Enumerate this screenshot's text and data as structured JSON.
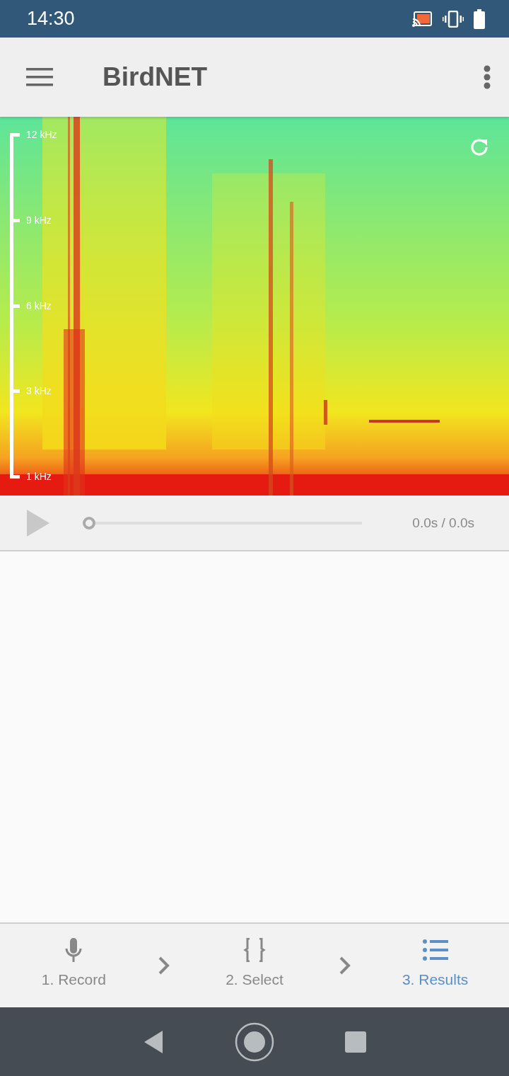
{
  "status_bar": {
    "time": "14:30"
  },
  "app_bar": {
    "title": "BirdNET"
  },
  "spectrogram": {
    "frequency_labels": [
      "12 kHz",
      "9 kHz",
      "6 kHz",
      "3 kHz",
      "1 kHz"
    ]
  },
  "player": {
    "playing": false,
    "level": 0,
    "time": "0.0s / 0.0s"
  },
  "steps": [
    {
      "label": "1. Record",
      "kind": "mic",
      "selected": false
    },
    {
      "label": "2. Select",
      "kind": "braces",
      "selected": false
    },
    {
      "label": "3. Results",
      "kind": "list",
      "selected": true
    }
  ]
}
